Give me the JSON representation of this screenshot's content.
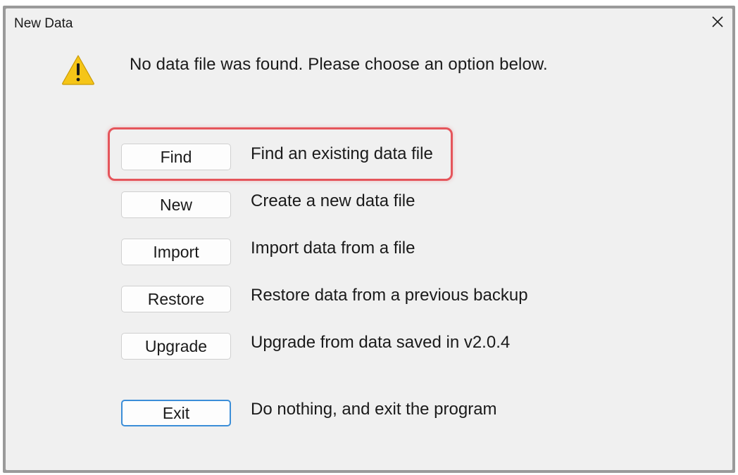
{
  "window": {
    "title": "New Data",
    "close_glyph": "✕"
  },
  "message": "No data file was found.  Please choose an option below.",
  "icons": {
    "warning": "warning-icon",
    "close": "close-icon"
  },
  "options": [
    {
      "label": "Find",
      "description": "Find an existing data file"
    },
    {
      "label": "New",
      "description": "Create a new data file"
    },
    {
      "label": "Import",
      "description": "Import data from a file"
    },
    {
      "label": "Restore",
      "description": "Restore data from a previous backup"
    },
    {
      "label": "Upgrade",
      "description": "Upgrade from data saved in v2.0.4"
    },
    {
      "label": "Exit",
      "description": "Do nothing, and exit the program"
    }
  ],
  "colors": {
    "highlight": "#e5555b",
    "focus_border": "#3b8ed8",
    "warning_fill": "#f5c518"
  }
}
